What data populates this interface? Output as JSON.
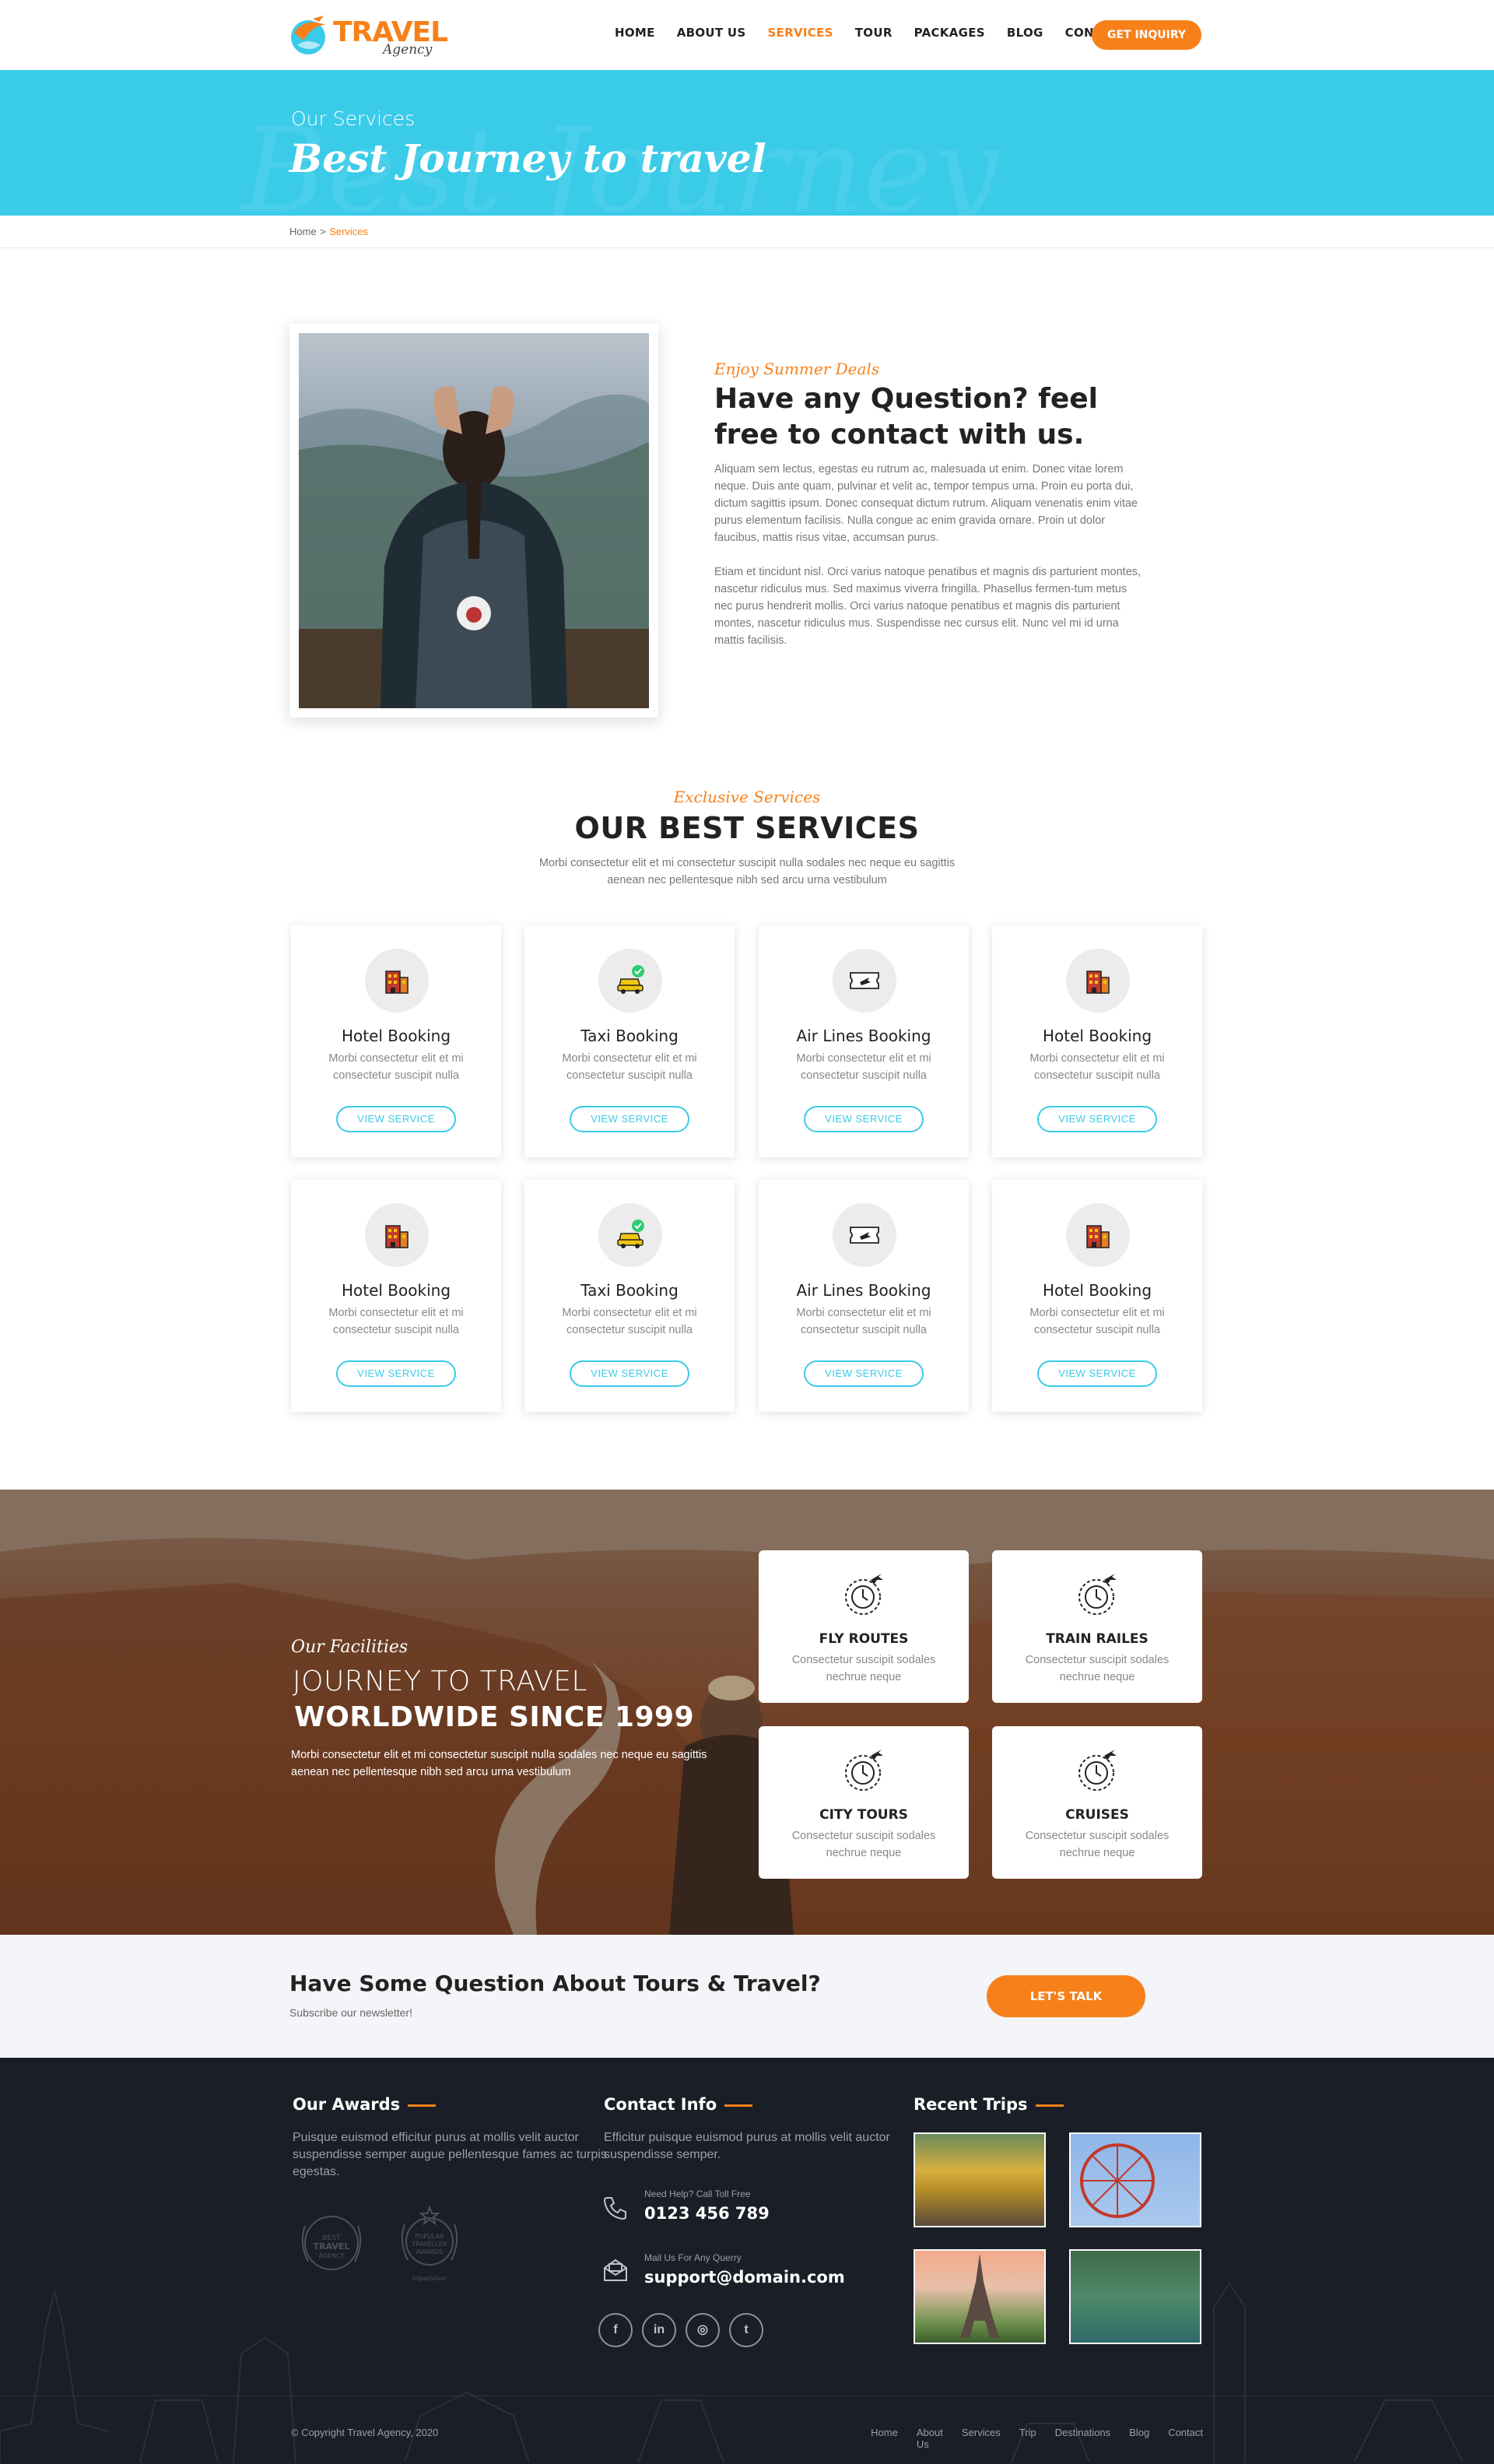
{
  "header": {
    "logo": {
      "word1": "TRAVEL",
      "word2": "Agency"
    },
    "nav": [
      "HOME",
      "ABOUT US",
      "SERVICES",
      "TOUR",
      "PACKAGES",
      "BLOG",
      "CONTACT"
    ],
    "active_nav": "SERVICES",
    "cta": "GET INQUIRY"
  },
  "banner": {
    "subtitle": "Our Services",
    "title": "Best Journey to travel",
    "ghost": "Best Journey"
  },
  "breadcrumb": {
    "home": "Home",
    "sep": ">",
    "current": "Services"
  },
  "about": {
    "script": "Enjoy Summer Deals",
    "title": "Have any Question? feel free to contact with us.",
    "para1": "Aliquam sem lectus, egestas eu rutrum ac, malesuada ut enim. Donec vitae lorem neque. Duis ante quam, pulvinar et velit ac, tempor tempus urna. Proin eu porta dui, dictum sagittis ipsum. Donec consequat dictum rutrum. Aliquam venenatis enim vitae purus elementum facilisis. Nulla congue ac enim gravida ornare. Proin ut dolor faucibus, mattis risus vitae, accumsan purus.",
    "para2": "Etiam et tincidunt nisl. Orci varius natoque penatibus et magnis dis parturient montes, nascetur ridiculus mus. Sed maximus viverra fringilla. Phasellus fermen-tum metus nec purus hendrerit mollis. Orci varius natoque penatibus et magnis dis parturient montes, nascetur ridiculus mus. Suspendisse nec cursus elit. Nunc vel mi id urna mattis facilisis."
  },
  "services": {
    "script": "Exclusive Services",
    "title": "OUR BEST SERVICES",
    "desc": "Morbi consectetur elit et mi consectetur suscipit nulla sodales nec neque eu sagittis aenean nec pellentesque nibh sed arcu urna vestibulum",
    "cards": [
      {
        "title": "Hotel Booking",
        "desc": "Morbi consectetur elit et mi consectetur suscipit nulla",
        "btn": "VIEW SERVICE",
        "icon": "hotel-icon"
      },
      {
        "title": "Taxi Booking",
        "desc": "Morbi consectetur elit et mi consectetur suscipit nulla",
        "btn": "VIEW SERVICE",
        "icon": "taxi-icon"
      },
      {
        "title": "Air Lines Booking",
        "desc": "Morbi consectetur elit et mi consectetur suscipit nulla",
        "btn": "VIEW SERVICE",
        "icon": "ticket-icon"
      },
      {
        "title": "Hotel Booking",
        "desc": "Morbi consectetur elit et mi consectetur suscipit nulla",
        "btn": "VIEW SERVICE",
        "icon": "hotel-icon"
      },
      {
        "title": "Hotel Booking",
        "desc": "Morbi consectetur elit et mi consectetur suscipit nulla",
        "btn": "VIEW SERVICE",
        "icon": "hotel-icon"
      },
      {
        "title": "Taxi Booking",
        "desc": "Morbi consectetur elit et mi consectetur suscipit nulla",
        "btn": "VIEW SERVICE",
        "icon": "taxi-icon"
      },
      {
        "title": "Air Lines Booking",
        "desc": "Morbi consectetur elit et mi consectetur suscipit nulla",
        "btn": "VIEW SERVICE",
        "icon": "ticket-icon"
      },
      {
        "title": "Hotel Booking",
        "desc": "Morbi consectetur elit et mi consectetur suscipit nulla",
        "btn": "VIEW SERVICE",
        "icon": "hotel-icon"
      }
    ]
  },
  "facilities": {
    "script": "Our Facilities",
    "line1": "JOURNEY TO TRAVEL",
    "line2": "WORLDWIDE SINCE 1999",
    "desc": "Morbi consectetur elit et mi consectetur suscipit nulla sodales nec neque eu sagittis aenean nec pellentesque nibh sed arcu urna vestibulum",
    "cards": [
      {
        "title": "FLY ROUTES",
        "desc": "Consectetur suscipit sodales nechrue neque"
      },
      {
        "title": "TRAIN RAILES",
        "desc": "Consectetur suscipit sodales nechrue neque"
      },
      {
        "title": "CITY TOURS",
        "desc": "Consectetur suscipit sodales nechrue neque"
      },
      {
        "title": "CRUISES",
        "desc": "Consectetur suscipit sodales nechrue neque"
      }
    ]
  },
  "subscribe": {
    "title": "Have Some Question About Tours & Travel?",
    "sub": "Subscribe our newsletter!",
    "btn": "LET'S TALK"
  },
  "footer": {
    "awards": {
      "title": "Our Awards",
      "text": "Puisque euismod efficitur purus at mollis velit auctor suspendisse semper augue pellentesque fames ac turpis egestas."
    },
    "contact": {
      "title": "Contact Info",
      "text": "Efficitur puisque euismod purus at mollis velit auctor suspendisse semper.",
      "phone_label": "Need Help? Call Toll Free",
      "phone": "0123 456 789",
      "mail_label": "Mail Us For Any Querry",
      "mail": "support@domain.com"
    },
    "trips": {
      "title": "Recent Trips"
    },
    "copyright": "© Copyright Travel Agency, 2020",
    "links": [
      "Home",
      "About Us",
      "Services",
      "Trip",
      "Destinations",
      "Blog",
      "Contact"
    ]
  },
  "colors": {
    "accent": "#f7801a",
    "cyan": "#3acbe8",
    "footer": "#1a1e26"
  }
}
